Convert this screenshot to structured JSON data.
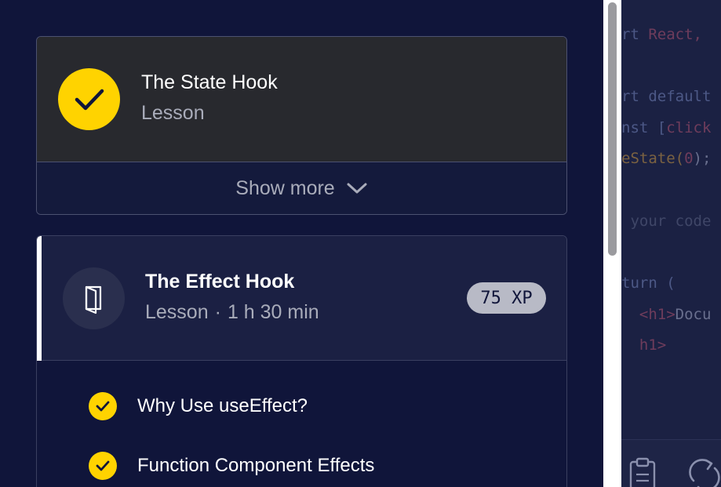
{
  "lessons": {
    "state_hook": {
      "title": "The State Hook",
      "type": "Lesson",
      "show_more_label": "Show more"
    },
    "effect_hook": {
      "title": "The Effect Hook",
      "type": "Lesson",
      "separator": "·",
      "duration": "1 h 30 min",
      "xp": "75 XP",
      "items": [
        {
          "label": "Why Use useEffect?",
          "completed": true
        },
        {
          "label": "Function Component Effects",
          "completed": true
        }
      ]
    }
  },
  "editor": {
    "lines": [
      {
        "a": "rt ",
        "b": "React,"
      },
      {
        "a": "rt default",
        "b": ""
      },
      {
        "a": "nst [",
        "b": "click"
      },
      {
        "a": "eState(",
        "b": "0",
        "c": ");"
      },
      {
        "a": " your code",
        "b": ""
      },
      {
        "a": "turn (",
        "b": ""
      },
      {
        "a": "  <h1>",
        "b": "Docu"
      },
      {
        "a": "  h1>",
        "b": ""
      }
    ]
  },
  "colors": {
    "accent_yellow": "#ffd300",
    "page_bg": "#10153a",
    "card_dark": "#28292e",
    "active_card": "#1b2043"
  },
  "icons": {
    "completed": "checkmark-icon",
    "lesson": "book-icon",
    "expand": "chevron-down-icon",
    "clipboard": "clipboard-icon",
    "refresh": "refresh-icon"
  }
}
